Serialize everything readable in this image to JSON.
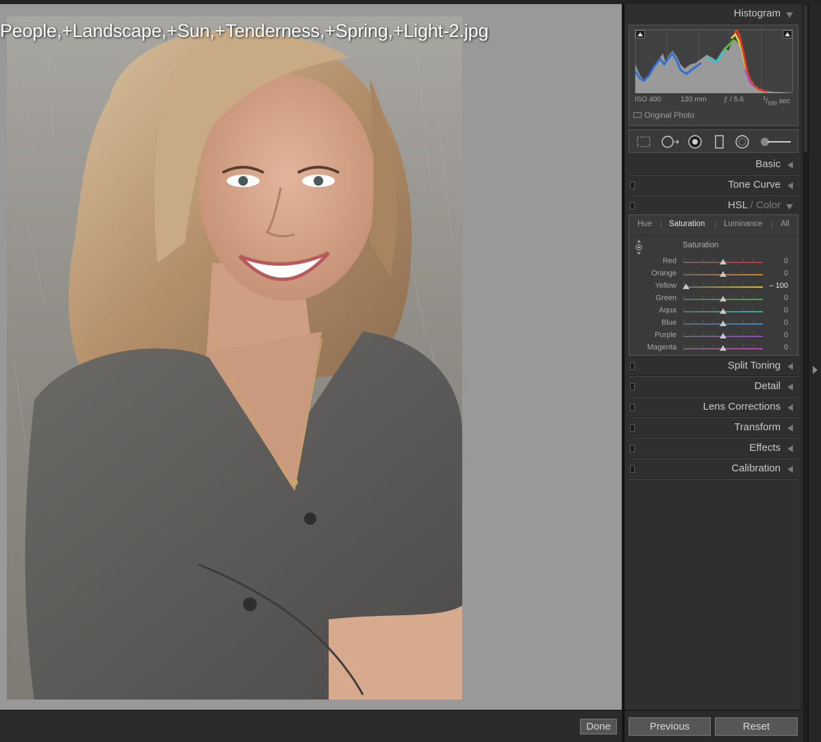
{
  "photo": {
    "filename": "People,+Landscape,+Sun,+Tenderness,+Spring,+Light-2.jpg"
  },
  "bottom_bar": {
    "done_label": "Done"
  },
  "histogram": {
    "title": "Histogram",
    "exif": {
      "iso": "ISO 400",
      "focal": "120 mm",
      "aperture": "ƒ / 5.6",
      "shutter_num": "1",
      "shutter_den": "500",
      "shutter_unit": "sec"
    },
    "original_photo_label": "Original Photo"
  },
  "tools": [
    {
      "name": "crop-overlay-icon"
    },
    {
      "name": "spot-removal-icon"
    },
    {
      "name": "red-eye-icon"
    },
    {
      "name": "graduated-filter-icon"
    },
    {
      "name": "radial-filter-icon"
    },
    {
      "name": "adjustment-brush-icon"
    }
  ],
  "panels": {
    "basic": "Basic",
    "tone_curve": "Tone Curve",
    "hsl_a": "HSL",
    "hsl_sep": " / ",
    "hsl_b": "Color",
    "split_toning": "Split Toning",
    "detail": "Detail",
    "lens_corrections": "Lens Corrections",
    "transform": "Transform",
    "effects": "Effects",
    "calibration": "Calibration"
  },
  "hsl": {
    "tabs": [
      "Hue",
      "Saturation",
      "Luminance",
      "All"
    ],
    "active_tab": "Saturation",
    "section_title": "Saturation",
    "sliders": [
      {
        "label": "Red",
        "value": "0",
        "numeric": 0,
        "color": "#c0392b"
      },
      {
        "label": "Orange",
        "value": "0",
        "numeric": 0,
        "color": "#d9822b"
      },
      {
        "label": "Yellow",
        "value": "– 100",
        "numeric": -100,
        "color": "#d8c23a"
      },
      {
        "label": "Green",
        "value": "0",
        "numeric": 0,
        "color": "#3fae3f"
      },
      {
        "label": "Aqua",
        "value": "0",
        "numeric": 0,
        "color": "#33b3a6"
      },
      {
        "label": "Blue",
        "value": "0",
        "numeric": 0,
        "color": "#3a87c9"
      },
      {
        "label": "Purple",
        "value": "0",
        "numeric": 0,
        "color": "#8e4ec6"
      },
      {
        "label": "Magenta",
        "value": "0",
        "numeric": 0,
        "color": "#c83fae"
      }
    ],
    "slider_range": [
      -100,
      100
    ]
  },
  "footer": {
    "previous_label": "Previous",
    "reset_label": "Reset"
  }
}
